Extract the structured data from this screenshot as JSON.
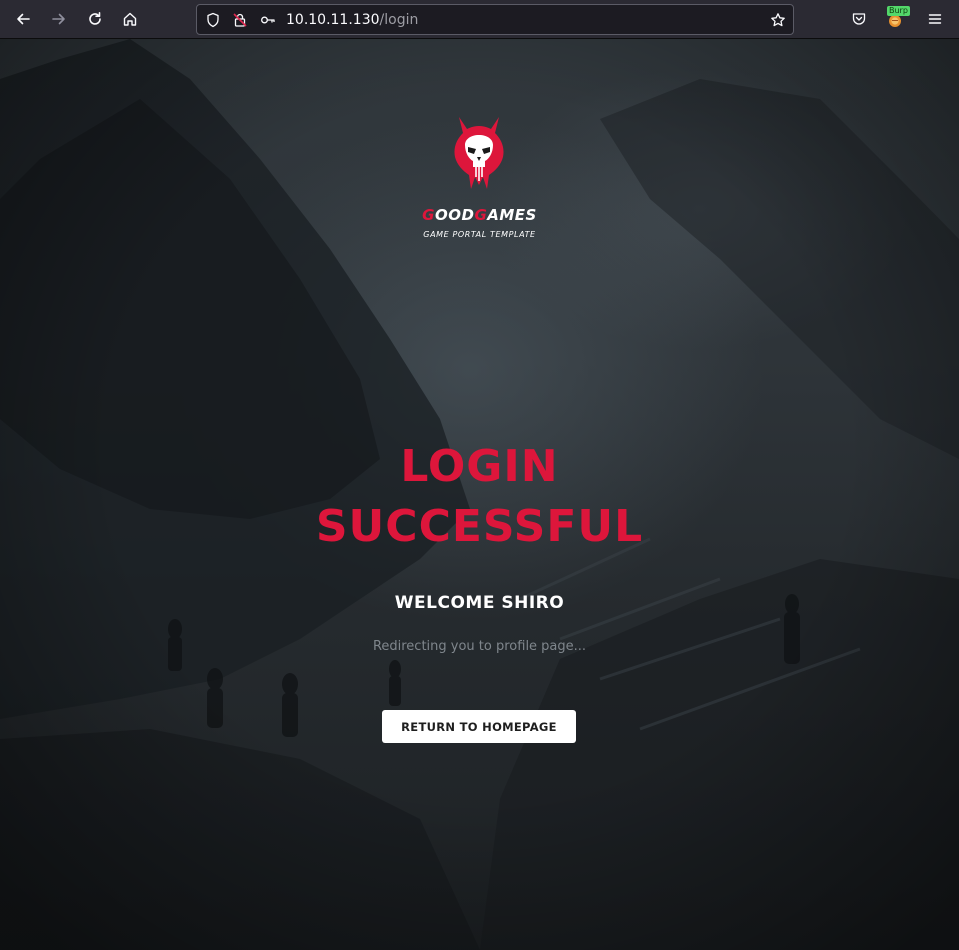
{
  "browser": {
    "url_host": "10.10.11.130",
    "url_path": "/login",
    "burp_badge": "Burp",
    "icons": [
      "back-arrow-icon",
      "forward-arrow-icon",
      "reload-icon",
      "home-icon",
      "shield-icon",
      "insecure-lock-icon",
      "key-icon",
      "star-icon",
      "pocket-icon",
      "burp-extension-icon",
      "menu-icon"
    ]
  },
  "logo": {
    "brand_first": "G",
    "brand_mid1": "OOD",
    "brand_second": "G",
    "brand_mid2": "AMES",
    "tagline": "GAME PORTAL TEMPLATE",
    "icon": "skull-logo-icon",
    "accent_color": "#dd163b"
  },
  "main": {
    "headline_line1": "LOGIN",
    "headline_line2": "SUCCESSFUL",
    "welcome": "WELCOME SHIRO",
    "redirect_text": "Redirecting you to profile page...",
    "return_button": "RETURN TO HOMEPAGE"
  }
}
